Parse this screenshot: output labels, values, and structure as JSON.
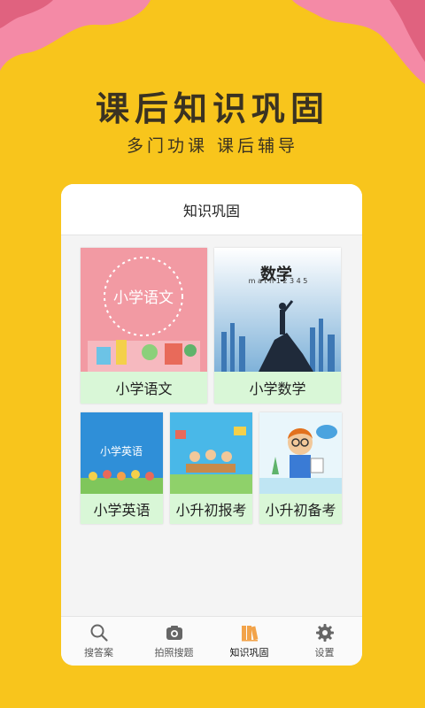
{
  "headline": "课后知识巩固",
  "subline": "多门功课   课后辅导",
  "app": {
    "title": "知识巩固",
    "courses": [
      {
        "label": "小学语文",
        "thumb_text": "小学语文",
        "icon": "chinese-course-thumbnail"
      },
      {
        "label": "小学数学",
        "thumb_text": "数学",
        "thumb_subtext": "m a t h 1 2 3 4 5",
        "icon": "math-course-thumbnail"
      },
      {
        "label": "小学英语",
        "thumb_text": "小学英语",
        "icon": "english-course-thumbnail"
      },
      {
        "label": "小升初报考",
        "icon": "exam-apply-thumbnail"
      },
      {
        "label": "小升初备考",
        "icon": "exam-prep-thumbnail"
      }
    ],
    "tabs": [
      {
        "label": "搜答案",
        "icon": "search-icon"
      },
      {
        "label": "拍照搜题",
        "icon": "camera-icon"
      },
      {
        "label": "知识巩固",
        "icon": "books-icon",
        "active": true
      },
      {
        "label": "设置",
        "icon": "gear-icon"
      }
    ]
  },
  "colors": {
    "background": "#f8c51c",
    "accent_pink": "#f48aa6",
    "label_green": "#d9f7d7",
    "active_tab": "#f2a34a"
  }
}
